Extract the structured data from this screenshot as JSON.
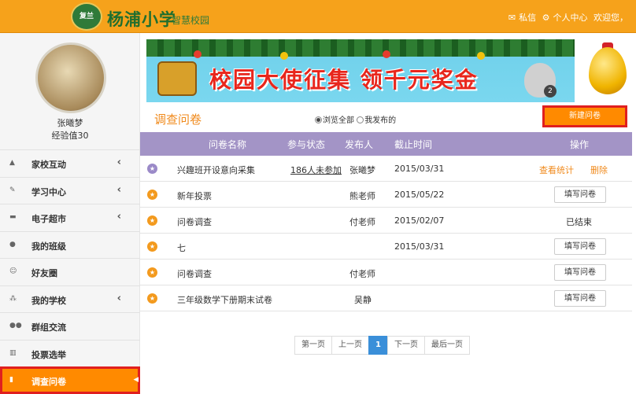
{
  "header": {
    "logo_text": "复兰",
    "school_name": "杨浦小学",
    "school_sub": "智慧校园",
    "messages_label": "私信",
    "profile_label": "个人中心",
    "welcome_text": "欢迎您，"
  },
  "user": {
    "name": "张曦梦",
    "exp": "经验值30"
  },
  "sidebar": {
    "items": [
      {
        "label": "家校互动",
        "icon": "home-icon",
        "chevron": "‹"
      },
      {
        "label": "学习中心",
        "icon": "edit-icon",
        "chevron": "‹"
      },
      {
        "label": "电子超市",
        "icon": "cart-icon",
        "chevron": "‹"
      },
      {
        "label": "我的班级",
        "icon": "user-icon",
        "chevron": ""
      },
      {
        "label": "好友圈",
        "icon": "smile-icon",
        "chevron": ""
      },
      {
        "label": "我的学校",
        "icon": "sitemap-icon",
        "chevron": "‹"
      },
      {
        "label": "群组交流",
        "icon": "group-icon",
        "chevron": ""
      },
      {
        "label": "投票选举",
        "icon": "bar-chart-icon",
        "chevron": ""
      },
      {
        "label": "调查问卷",
        "icon": "file-icon",
        "chevron": "◂"
      }
    ]
  },
  "banner": {
    "text": "校园大使征集 领千元奖金",
    "badge": "2"
  },
  "main": {
    "title": "调查问卷",
    "filter_all": "浏览全部",
    "filter_mine": "我发布的",
    "new_button": "新建问卷"
  },
  "table": {
    "headers": {
      "name": "问卷名称",
      "status": "参与状态",
      "publisher": "发布人",
      "deadline": "截止时间",
      "actions": "操作"
    },
    "rows": [
      {
        "name": "兴趣班开设意向采集",
        "status": "186人未参加",
        "publisher": "张曦梦",
        "deadline": "2015/03/31",
        "action1": "查看统计",
        "action2": "删除",
        "icon_color": "#9b8ac8"
      },
      {
        "name": "新年投票",
        "status": "",
        "publisher": "熊老师",
        "deadline": "2015/05/22",
        "action_button": "填写问卷",
        "icon_color": "#f39a1e"
      },
      {
        "name": "问卷调查",
        "status": "",
        "publisher": "付老师",
        "deadline": "2015/02/07",
        "action_text": "已结束",
        "icon_color": "#f39a1e"
      },
      {
        "name": "七",
        "status": "",
        "publisher": "",
        "deadline": "2015/03/31",
        "action_button": "填写问卷",
        "icon_color": "#f39a1e"
      },
      {
        "name": "问卷调查",
        "status": "",
        "publisher": "付老师",
        "deadline": "",
        "action_button": "填写问卷",
        "icon_color": "#f39a1e"
      },
      {
        "name": "三年级数学下册期末试卷",
        "status": "",
        "publisher": "吴静",
        "deadline": "",
        "action_button": "填写问卷",
        "icon_color": "#f39a1e"
      }
    ]
  },
  "pagination": {
    "first": "第一页",
    "prev": "上一页",
    "current": "1",
    "next": "下一页",
    "last": "最后一页"
  },
  "colors": {
    "header_bg": "#f6a21b",
    "accent_orange": "#ff8a00",
    "table_header": "#a394c6",
    "highlight_red": "#e01f1f",
    "pager_active": "#3a8fd9"
  }
}
